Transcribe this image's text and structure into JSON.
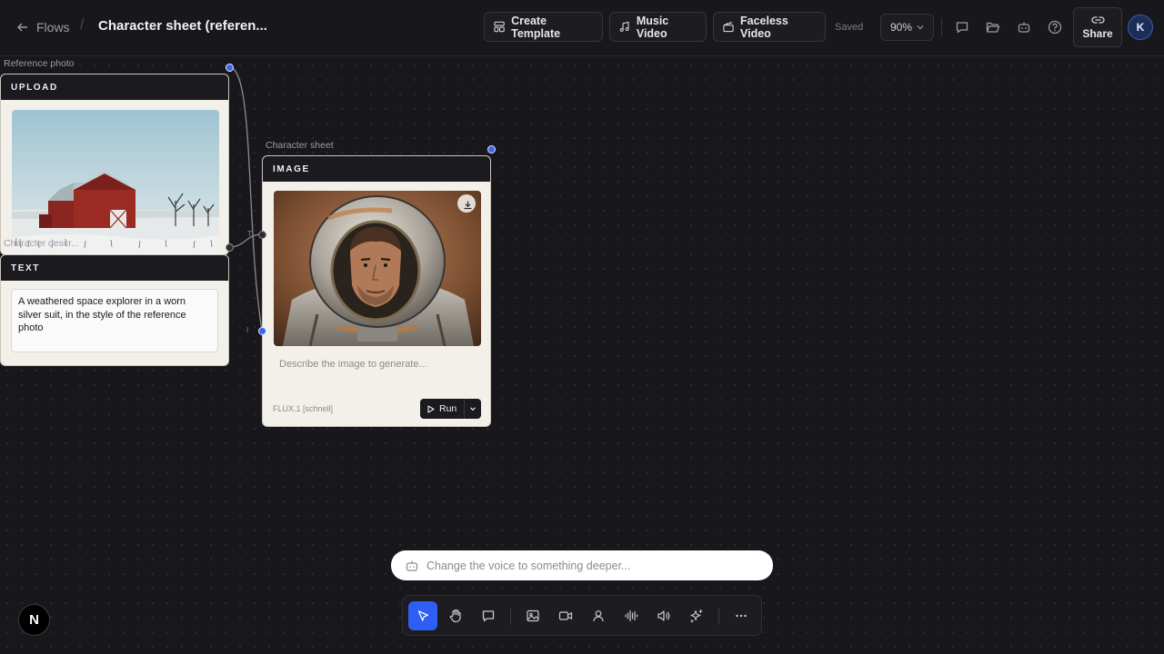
{
  "header": {
    "back_label": "Flows",
    "separator": "/",
    "title": "Character sheet (referen...",
    "buttons": {
      "create_template": "Create Template",
      "music_video": "Music Video",
      "faceless_video": "Faceless Video"
    },
    "status": "Saved",
    "zoom": "90%",
    "share_label": "Share",
    "avatar_initial": "K"
  },
  "nodes": {
    "upload": {
      "label": "Reference photo",
      "type": "UPLOAD",
      "image_alt": "Red barn in a snowy field"
    },
    "text": {
      "label": "Character descr...",
      "type": "TEXT",
      "content": "A weathered space explorer in a worn silver suit, in the style of the reference photo"
    },
    "image": {
      "label": "Character sheet",
      "type": "IMAGE",
      "prompt_placeholder": "Describe the image to generate...",
      "model": "FLUX.1 [schnell]",
      "run_label": "Run",
      "handle_t": "T",
      "handle_i": "I"
    }
  },
  "chat": {
    "placeholder": "Change the voice to something deeper..."
  },
  "badge": "N",
  "colors": {
    "background": "#18181c",
    "accent": "#2f5ef5",
    "node_body": "#f3f0ea",
    "node_header": "#1a1a1f"
  }
}
